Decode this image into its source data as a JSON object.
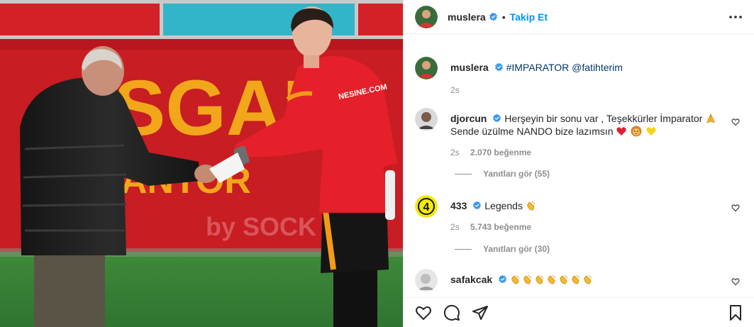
{
  "header": {
    "username": "muslera",
    "separator": "•",
    "follow_label": "Takip Et"
  },
  "caption": {
    "username": "muslera",
    "hashtag": "#IMPARATOR",
    "mention": "@fatihterim",
    "time": "2s"
  },
  "comments": [
    {
      "username": "djorcun",
      "verified": true,
      "text_line1": "Herşeyin bir sonu var , Teşekkürler İmparator",
      "text_line2": "Sende üzülme NANDO bize lazımsın",
      "time": "2s",
      "likes": "2.070 beğenme",
      "replies": "Yanıtları gör (55)"
    },
    {
      "username": "433",
      "verified": true,
      "text_line1": "Legends",
      "time": "2s",
      "likes": "5.743 beğenme",
      "replies": "Yanıtları gör (30)"
    },
    {
      "username": "safakcak",
      "verified": true,
      "emoji_count": 7
    }
  ],
  "photo": {
    "banner_text_1": "SGAL",
    "banner_text_2": "ANTOR",
    "banner_text_3": "by SOCK",
    "shirt_text": "NESINE.COM"
  },
  "icons": {
    "more": "more-options-icon",
    "like": "heart-icon",
    "comment": "comment-icon",
    "share": "share-icon",
    "save": "bookmark-icon"
  },
  "colors": {
    "accent": "#0095f6",
    "verified": "#3897f0",
    "link": "#00376b",
    "muted": "#8e8e8e"
  }
}
